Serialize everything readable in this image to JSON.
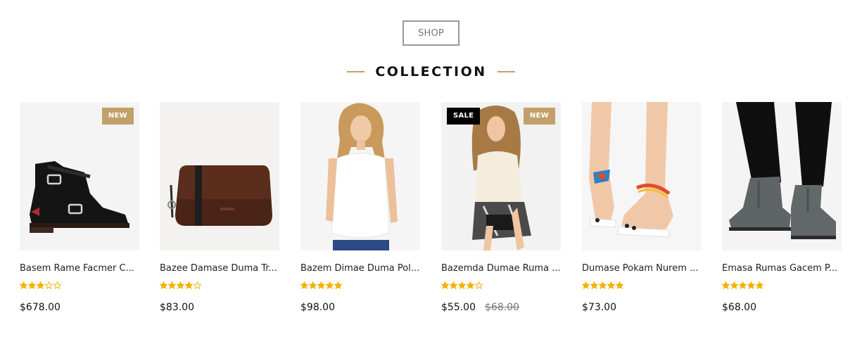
{
  "shop_button": {
    "label": "SHOP"
  },
  "heading": {
    "title": "COLLECTION"
  },
  "colors": {
    "accent": "#c3a06b",
    "sale_badge": "#000000",
    "star": "#f5b100"
  },
  "products": [
    {
      "name": "Basem Rame Facmer C...",
      "rating": 3,
      "price": "$678.00",
      "old_price": "",
      "badges": [
        "NEW"
      ],
      "image": "black-buckle-boot"
    },
    {
      "name": "Bazee Damase Duma Tr...",
      "rating": 4,
      "price": "$83.00",
      "old_price": "",
      "badges": [],
      "image": "brown-leather-bag"
    },
    {
      "name": "Bazem Dimae Duma Pol...",
      "rating": 5,
      "price": "$98.00",
      "old_price": "",
      "badges": [],
      "image": "woman-white-top"
    },
    {
      "name": "Bazemda Dumae Ruma ...",
      "rating": 4,
      "price": "$55.00",
      "old_price": "$68.00",
      "badges": [
        "SALE",
        "NEW"
      ],
      "image": "woman-shorts-outfit"
    },
    {
      "name": "Dumase Pokam Nurem ...",
      "rating": 5,
      "price": "$73.00",
      "old_price": "",
      "badges": [],
      "image": "beaded-sandals"
    },
    {
      "name": "Emasa Rumas Gacem P...",
      "rating": 5,
      "price": "$68.00",
      "old_price": "",
      "badges": [],
      "image": "grey-chelsea-boots"
    }
  ]
}
